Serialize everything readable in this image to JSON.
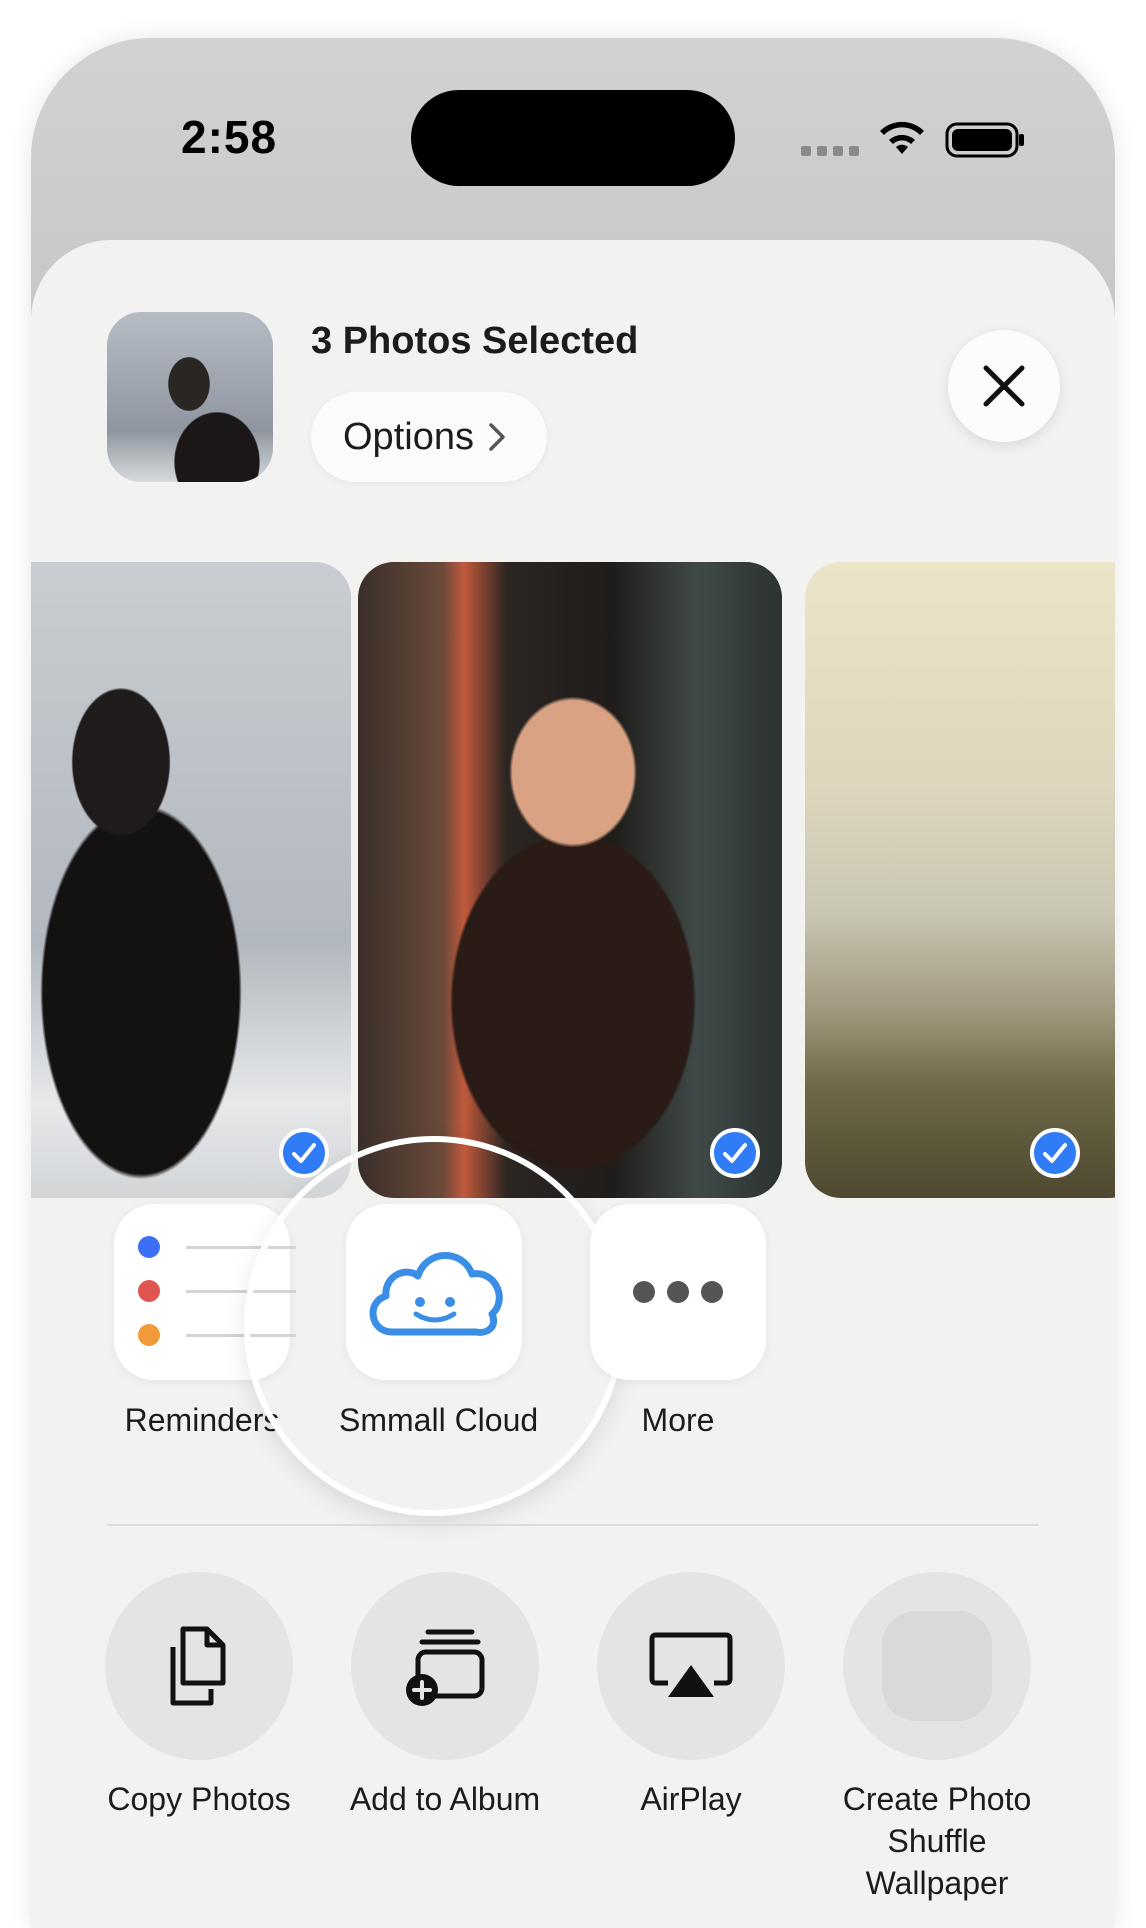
{
  "status_bar": {
    "time": "2:58",
    "icons": [
      "cellular-signal-icon",
      "wifi-icon",
      "battery-icon"
    ]
  },
  "share_sheet": {
    "title": "3 Photos Selected",
    "options_label": "Options",
    "close_icon": "close-icon",
    "photos": [
      {
        "name": "photo-woman-hair-gray",
        "selected": true
      },
      {
        "name": "photo-woman-drinking",
        "selected": true
      },
      {
        "name": "photo-sea-shore",
        "selected": true
      }
    ],
    "apps": [
      {
        "label": "Reminders",
        "icon": "reminders-icon"
      },
      {
        "label": "Smmall Cloud",
        "icon": "smiling-cloud-icon",
        "highlighted": true
      },
      {
        "label": "More",
        "icon": "more-dots-icon"
      }
    ],
    "actions": [
      {
        "label": "Copy Photos",
        "icon": "copy-icon"
      },
      {
        "label": "Add to Album",
        "icon": "add-to-album-icon"
      },
      {
        "label": "AirPlay",
        "icon": "airplay-icon"
      },
      {
        "label": "Create Photo Shuffle Wallpaper",
        "icon": "wallpaper-icon"
      }
    ]
  },
  "colors": {
    "accent": "#2f7cf6",
    "cloud": "#3a8ee6",
    "sheet_bg": "#f2f2f1"
  }
}
